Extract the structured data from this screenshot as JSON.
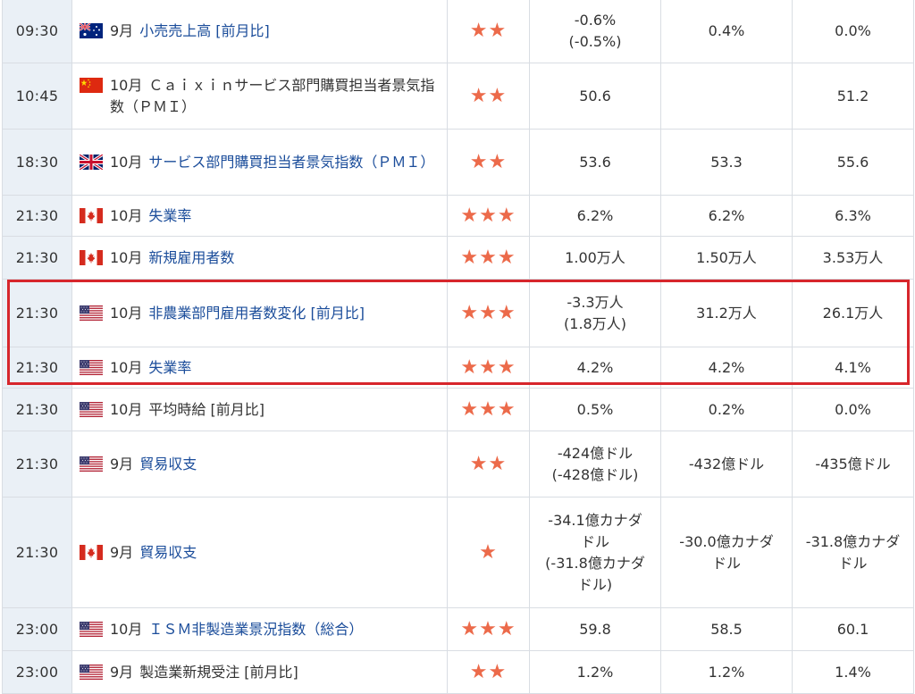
{
  "rows": [
    {
      "time": "09:30",
      "flag": "au",
      "month": "9月",
      "name": "小売売上高 [前月比]",
      "linked": true,
      "stars": "★★",
      "prev": "-0.6%\n(-0.5%)",
      "forecast": "0.4%",
      "actual": "0.0%"
    },
    {
      "time": "10:45",
      "flag": "cn",
      "month": "10月",
      "name": "Ｃａｉｘｉｎサービス部門購買担当者景気指数（ＰＭＩ）",
      "linked": false,
      "stars": "★★",
      "prev": "50.6",
      "forecast": "",
      "actual": "51.2"
    },
    {
      "time": "18:30",
      "flag": "gb",
      "month": "10月",
      "name": "サービス部門購買担当者景気指数（ＰＭＩ）",
      "linked": true,
      "stars": "★★",
      "prev": "53.6",
      "forecast": "53.3",
      "actual": "55.6"
    },
    {
      "time": "21:30",
      "flag": "ca",
      "month": "10月",
      "name": "失業率",
      "linked": true,
      "stars": "★★★",
      "prev": "6.2%",
      "forecast": "6.2%",
      "actual": "6.3%"
    },
    {
      "time": "21:30",
      "flag": "ca",
      "month": "10月",
      "name": "新規雇用者数",
      "linked": true,
      "stars": "★★★",
      "prev": "1.00万人",
      "forecast": "1.50万人",
      "actual": "3.53万人"
    },
    {
      "time": "21:30",
      "flag": "us",
      "month": "10月",
      "name": "非農業部門雇用者数変化 [前月比]",
      "linked": true,
      "stars": "★★★",
      "prev": "-3.3万人\n(1.8万人)",
      "forecast": "31.2万人",
      "actual": "26.1万人"
    },
    {
      "time": "21:30",
      "flag": "us",
      "month": "10月",
      "name": "失業率",
      "linked": true,
      "stars": "★★★",
      "prev": "4.2%",
      "forecast": "4.2%",
      "actual": "4.1%"
    },
    {
      "time": "21:30",
      "flag": "us",
      "month": "10月",
      "name": "平均時給 [前月比]",
      "linked": false,
      "stars": "★★★",
      "prev": "0.5%",
      "forecast": "0.2%",
      "actual": "0.0%"
    },
    {
      "time": "21:30",
      "flag": "us",
      "month": "9月",
      "name": "貿易収支",
      "linked": true,
      "stars": "★★",
      "prev": "-424億ドル\n(-428億ドル)",
      "forecast": "-432億ドル",
      "actual": "-435億ドル"
    },
    {
      "time": "21:30",
      "flag": "ca",
      "month": "9月",
      "name": "貿易収支",
      "linked": true,
      "stars": "★",
      "prev": "-34.1億カナダ\nドル\n(-31.8億カナダ\nドル)",
      "forecast": "-30.0億カナダ\nドル",
      "actual": "-31.8億カナダ\nドル"
    },
    {
      "time": "23:00",
      "flag": "us",
      "month": "10月",
      "name": "ＩＳＭ非製造業景況指数（総合）",
      "linked": true,
      "stars": "★★★",
      "prev": "59.8",
      "forecast": "58.5",
      "actual": "60.1"
    },
    {
      "time": "23:00",
      "flag": "us",
      "month": "9月",
      "name": "製造業新規受注 [前月比]",
      "linked": false,
      "stars": "★★",
      "prev": "1.2%",
      "forecast": "1.2%",
      "actual": "1.4%"
    }
  ]
}
